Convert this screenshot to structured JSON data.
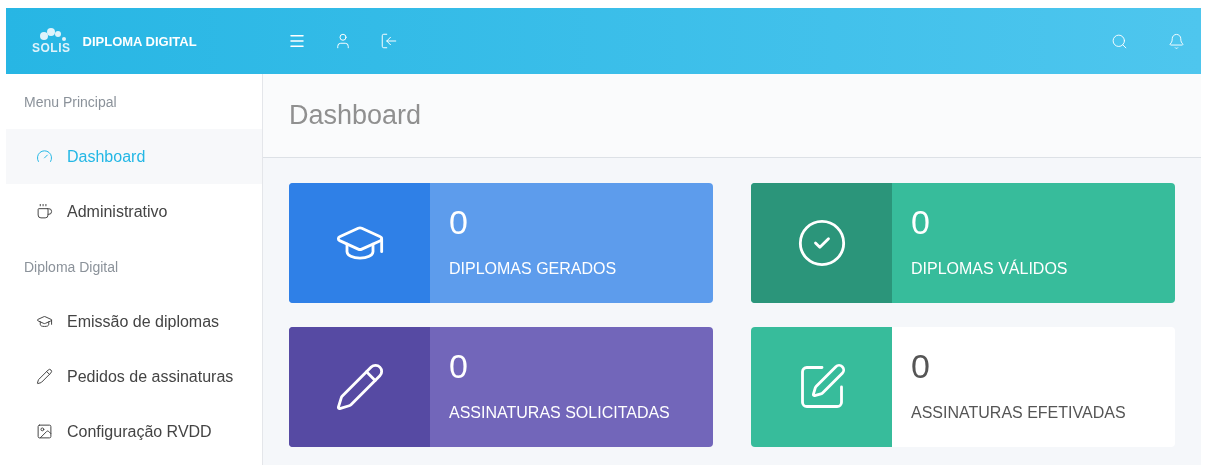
{
  "header": {
    "brand": "SOLIS",
    "app_title": "DIPLOMA DIGITAL"
  },
  "sidebar": {
    "sections": [
      {
        "heading": "Menu Principal",
        "items": [
          {
            "label": "Dashboard",
            "selected": true
          },
          {
            "label": "Administrativo",
            "selected": false
          }
        ]
      },
      {
        "heading": "Diploma Digital",
        "items": [
          {
            "label": "Emissão de diplomas",
            "selected": false
          },
          {
            "label": "Pedidos de assinaturas",
            "selected": false
          },
          {
            "label": "Configuração RVDD",
            "selected": false
          }
        ]
      }
    ]
  },
  "page_title": "Dashboard",
  "cards": [
    {
      "value": "0",
      "label": "DIPLOMAS GERADOS",
      "color": "#2f80e7",
      "kind": "tinted"
    },
    {
      "value": "0",
      "label": "DIPLOMAS VÁLIDOS",
      "color": "#2b957a",
      "kind": "tinted"
    },
    {
      "value": "0",
      "label": "ASSINATURAS SOLICITADAS",
      "color": "#564aa3",
      "kind": "tinted"
    },
    {
      "value": "0",
      "label": "ASSINATURAS EFETIVADAS",
      "color": "#37bc9b",
      "kind": "plain"
    }
  ]
}
